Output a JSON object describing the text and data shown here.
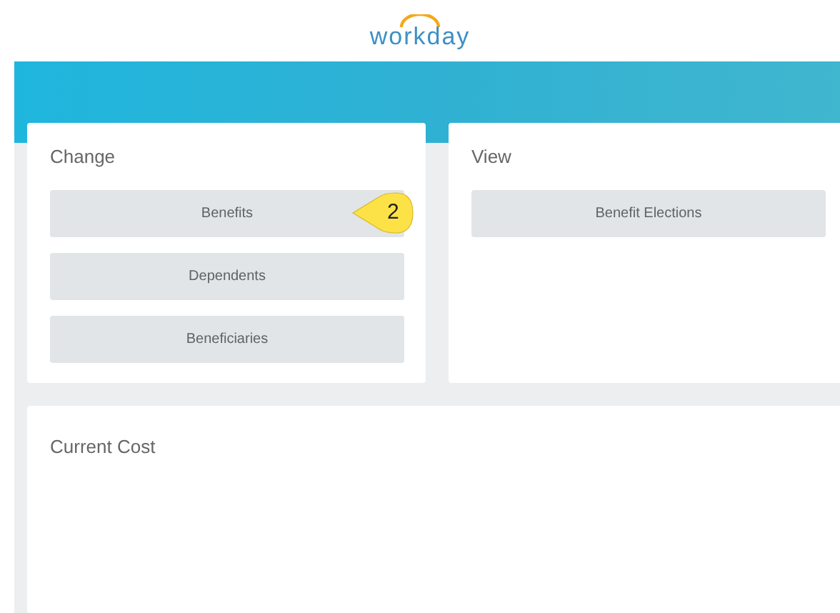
{
  "logo": {
    "text": "workday"
  },
  "change": {
    "title": "Change",
    "buttons": [
      {
        "label": "Benefits",
        "callout": "2"
      },
      {
        "label": "Dependents"
      },
      {
        "label": "Beneficiaries"
      }
    ]
  },
  "view": {
    "title": "View",
    "buttons": [
      {
        "label": "Benefit Elections"
      }
    ]
  },
  "current_cost": {
    "title": "Current Cost"
  }
}
